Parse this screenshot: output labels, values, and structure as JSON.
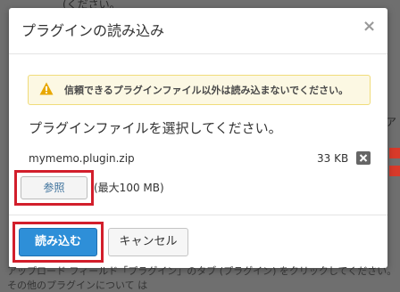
{
  "background": {
    "top_text": "(ください。",
    "right_text": "ア",
    "bottom_text": "アップロード フィールド「プラグイン」のタブ (プラグイン) をクリックしてください。その他のプラグインについて は"
  },
  "dialog": {
    "title": "プラグインの読み込み",
    "close_symbol": "×",
    "warning": "信頼できるプラグインファイル以外は読み込まないでください。",
    "instruction": "プラグインファイルを選択してください。",
    "file": {
      "name": "mymemo.plugin.zip",
      "size": "33 KB"
    },
    "browse_label": "参照",
    "limit_text": "(最大100 MB)",
    "import_label": "読み込む",
    "cancel_label": "キャンセル"
  },
  "colors": {
    "highlight": "#d21e2b",
    "primary": "#2e8fd8",
    "warning_bg": "#fcf8e3"
  }
}
